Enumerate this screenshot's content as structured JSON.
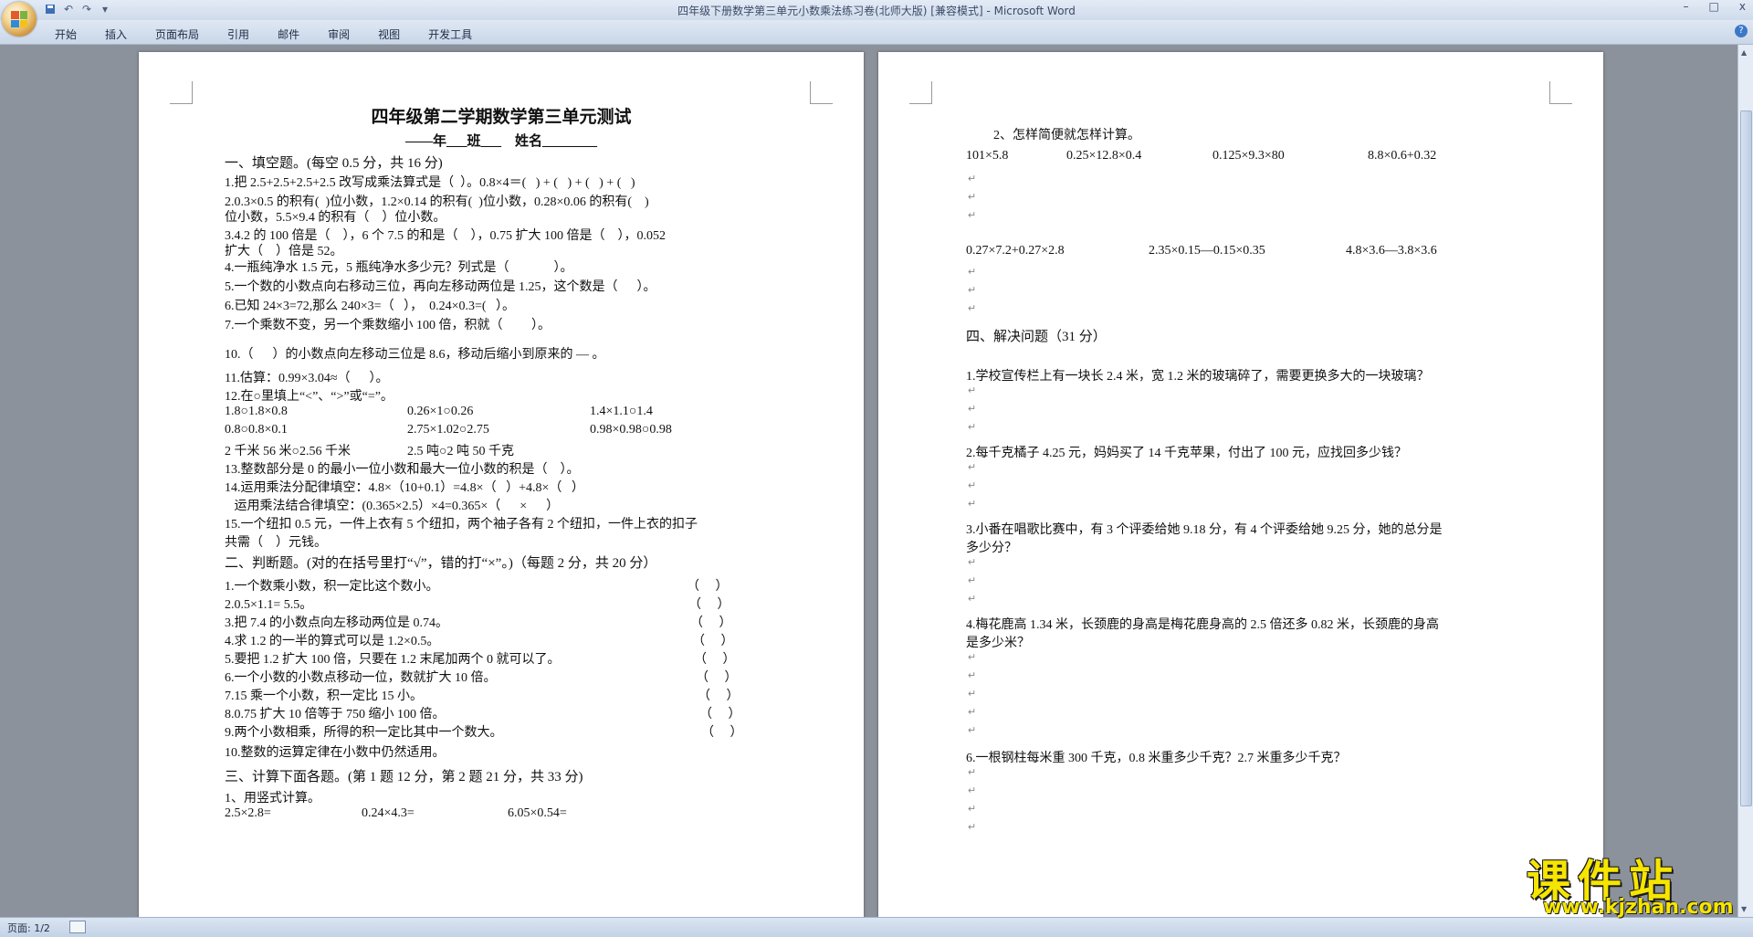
{
  "window": {
    "title": "四年级下册数学第三单元小数乘法练习卷(北师大版) [兼容模式] - Microsoft Word",
    "minimize": "–",
    "maximize": "□",
    "close": "x"
  },
  "ribbon": {
    "tabs": [
      "开始",
      "插入",
      "页面布局",
      "引用",
      "邮件",
      "审阅",
      "视图",
      "开发工具"
    ],
    "help": "?"
  },
  "status": {
    "page": "页面: 1/2"
  },
  "watermark": {
    "top": "课件站",
    "bottom": "www.kjzhan.com"
  },
  "page1": {
    "title": "四年级第二学期数学第三单元测试",
    "subtitle": "——年___班___    姓名________",
    "sec1_head": "一、填空题。(每空 0.5 分，共 16 分)",
    "sec1": [
      "1.把 2.5+2.5+2.5+2.5 改写成乘法算式是（  ）。0.8×4＝(   ) + (   ) + (   ) + (   )",
      "2.0.3×0.5 的积有(  )位小数，1.2×0.14 的积有(  )位小数，0.28×0.06 的积有(    )",
      "位小数，5.5×9.4 的积有（    ）位小数。",
      "3.4.2 的 100 倍是（    ），6 个 7.5 的和是（    ），0.75 扩大 100 倍是（    ），0.052",
      "扩大（    ）倍是 52。",
      "4.一瓶纯净水 1.5 元，5 瓶纯净水多少元？列式是（              ）。",
      "5.一个数的小数点向右移动三位，再向左移动两位是 1.25，这个数是（      ）。",
      "6.已知 24×3=72,那么 240×3=（   ），  0.24×0.3=(   ）。",
      "7.一个乘数不变，另一个乘数缩小 100 倍，积就（         ）。",
      "10.（      ）的小数点向左移动三位是 8.6，移动后缩小到原来的 — 。",
      "11.估算：0.99×3.04≈（      ）。",
      "12.在○里填上“<”、“>”或“=”。"
    ],
    "compare_row1": [
      "1.8○1.8×0.8",
      "0.26×1○0.26",
      "1.4×1.1○1.4"
    ],
    "compare_row2": [
      "0.8○0.8×0.1",
      "2.75×1.02○2.75",
      "0.98×0.98○0.98"
    ],
    "compare_row3": [
      "2 千米 56 米○2.56 千米",
      "2.5 吨○2 吨 50 千克"
    ],
    "sec1b": [
      "13.整数部分是 0 的最小一位小数和最大一位小数的积是（    ）。",
      "14.运用乘法分配律填空：4.8×（10+0.1）=4.8×（   ）+4.8×（   ）",
      "   运用乘法结合律填空：(0.365×2.5）×4=0.365×（      ×      ）",
      "15.一个纽扣 0.5 元，一件上衣有 5 个纽扣，两个袖子各有 2 个纽扣，一件上衣的扣子",
      "共需（    ）元钱。"
    ],
    "sec2_head": "二、判断题。(对的在括号里打“√”，错的打“×”。)（每题 2 分，共 20 分）",
    "sec2": [
      "1.一个数乘小数，积一定比这个数小。",
      "2.0.5×1.1= 5.5。",
      "3.把 7.4 的小数点向左移动两位是 0.74。",
      "4.求 1.2 的一半的算式可以是 1.2×0.5。",
      "5.要把 1.2 扩大 100 倍，只要在 1.2 末尾加两个 0 就可以了。",
      "6.一个小数的小数点移动一位，数就扩大 10 倍。",
      "7.15 乘一个小数，积一定比 15 小。",
      "8.0.75 扩大 10 倍等于 750 缩小 100 倍。",
      "9.两个小数相乘，所得的积一定比其中一个数大。",
      "10.整数的运算定律在小数中仍然适用。"
    ],
    "sec2_brackets": [
      "（     ）",
      "（     ）",
      "（     ）",
      "（     ）",
      "（     ）",
      "（     ）",
      "（     ）",
      "（     ）",
      "（     ）"
    ],
    "sec3_head": "三、计算下面各题。(第 1 题 12 分，第 2 题 21 分，共 33 分)",
    "sec3_sub1": "1、用竖式计算。",
    "sec3_row1": [
      "2.5×2.8=",
      "0.24×4.3=",
      "6.05×0.54="
    ]
  },
  "page2": {
    "sub2": "2、怎样简便就怎样计算。",
    "calc_row1": [
      "101×5.8",
      "0.25×12.8×0.4",
      "0.125×9.3×80",
      "8.8×0.6+0.32"
    ],
    "calc_row2": [
      "0.27×7.2+0.27×2.8",
      "2.35×0.15—0.15×0.35",
      "4.8×3.6—3.8×3.6"
    ],
    "sec4_head": "四、解决问题（31 分）",
    "problems": [
      "1.学校宣传栏上有一块长 2.4 米，宽 1.2 米的玻璃碎了，需要更换多大的一块玻璃？",
      "2.每千克橘子 4.25 元，妈妈买了 14 千克苹果，付出了 100 元，应找回多少钱？",
      "3.小番在唱歌比赛中，有 3 个评委给她 9.18 分，有 4 个评委给她 9.25 分，她的总分是",
      "多少分？",
      "4.梅花鹿高 1.34 米，长颈鹿的身高是梅花鹿身高的 2.5 倍还多 0.82 米，长颈鹿的身高",
      "是多少米？",
      "6.一根钢柱每米重 300 千克，0.8 米重多少千克？2.7 米重多少千克？"
    ],
    "para_mark": "↵"
  }
}
